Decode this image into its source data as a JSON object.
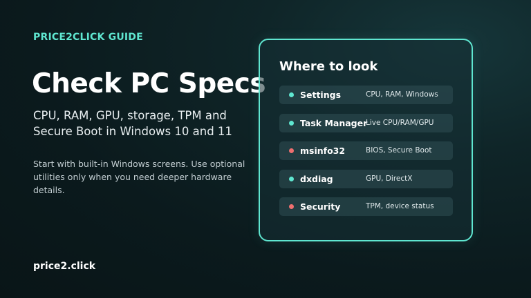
{
  "kicker": "PRICE2CLICK GUIDE",
  "title": "Check PC Specs",
  "subtitle": "CPU, RAM, GPU, storage, TPM and Secure Boot in Windows 10 and 11",
  "body": "Start with built-in Windows screens. Use optional utilities only when you need deeper hardware details.",
  "footer_brand": "price2.click",
  "colors": {
    "accent": "#5fe6d0",
    "teal_dot": "#5fe6d0",
    "red_dot": "#ef6f6f",
    "background": "#0b1a1d"
  },
  "card": {
    "title": "Where to look",
    "rows": [
      {
        "label": "Settings",
        "desc": "CPU, RAM, Windows",
        "dot": "teal"
      },
      {
        "label": "Task Manager",
        "desc": "Live CPU/RAM/GPU",
        "dot": "teal"
      },
      {
        "label": "msinfo32",
        "desc": "BIOS, Secure Boot",
        "dot": "red"
      },
      {
        "label": "dxdiag",
        "desc": "GPU, DirectX",
        "dot": "teal"
      },
      {
        "label": "Security",
        "desc": "TPM, device status",
        "dot": "red"
      }
    ]
  }
}
